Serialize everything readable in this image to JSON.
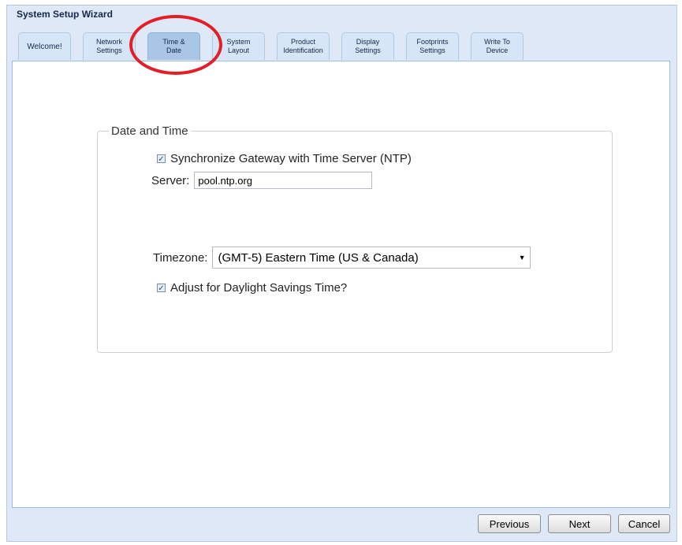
{
  "window": {
    "title": "System Setup Wizard"
  },
  "tabs": [
    {
      "label": "Welcome!"
    },
    {
      "label": "Network\nSettings"
    },
    {
      "label": "Time &\nDate"
    },
    {
      "label": "System\nLayout"
    },
    {
      "label": "Product\nIdentification"
    },
    {
      "label": "Display\nSettings"
    },
    {
      "label": "Footprints\nSettings"
    },
    {
      "label": "Write To\nDevice"
    }
  ],
  "active_tab": "Time & Date",
  "date_time": {
    "legend": "Date and Time",
    "sync_label": "Synchronize Gateway with Time Server (NTP)",
    "sync_checked": true,
    "server_label": "Server:",
    "server_value": "pool.ntp.org",
    "timezone_label": "Timezone:",
    "timezone_value": "(GMT-5) Eastern Time (US & Canada)",
    "dst_label": "Adjust for Daylight Savings Time?",
    "dst_checked": true
  },
  "buttons": {
    "previous": "Previous",
    "next": "Next",
    "cancel": "Cancel"
  },
  "colors": {
    "highlight": "#e21e26",
    "accent": "#a9c6e6"
  }
}
